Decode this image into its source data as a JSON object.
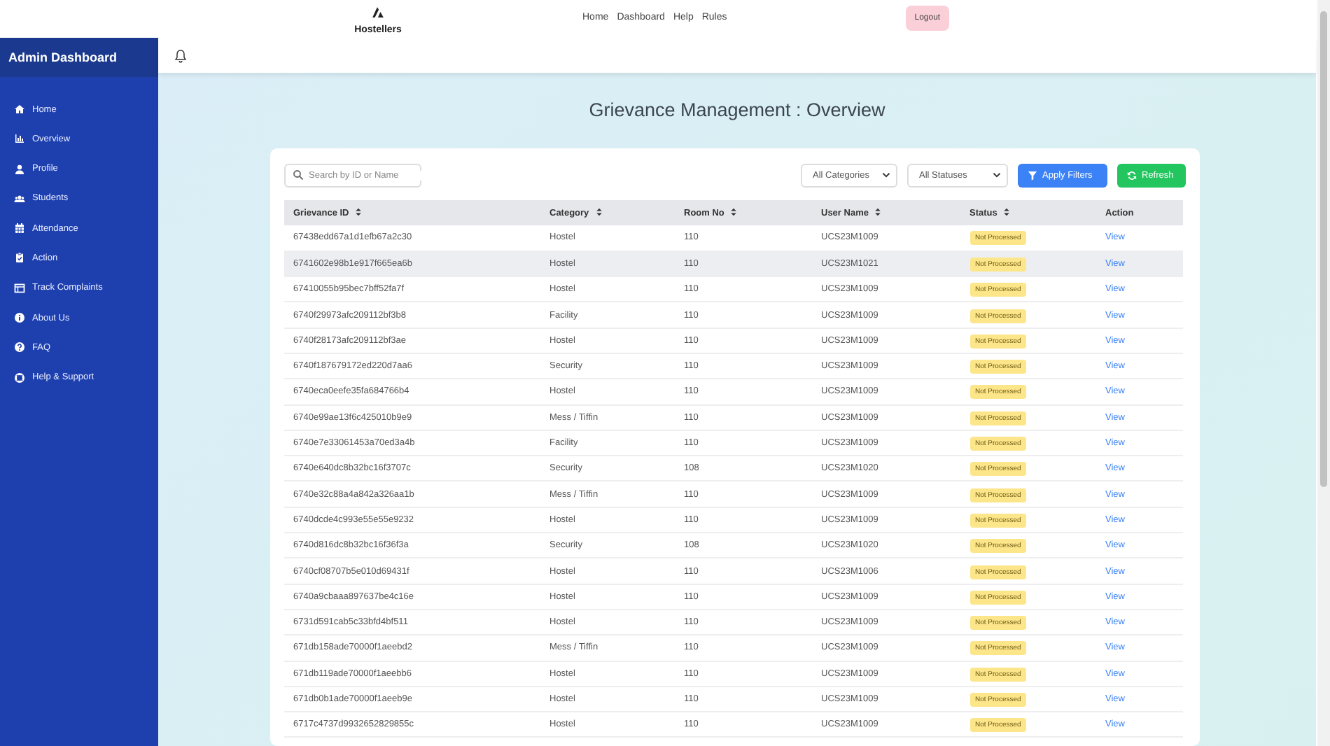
{
  "header": {
    "brand": "Hostellers",
    "nav": [
      "Home",
      "Dashboard",
      "Help",
      "Rules"
    ],
    "logout": "Logout"
  },
  "sidebar": {
    "title": "Admin Dashboard",
    "items": [
      {
        "label": "Home"
      },
      {
        "label": "Overview"
      },
      {
        "label": "Profile"
      },
      {
        "label": "Students"
      },
      {
        "label": "Attendance"
      },
      {
        "label": "Action"
      },
      {
        "label": "Track Complaints"
      },
      {
        "label": "About Us"
      },
      {
        "label": "FAQ"
      },
      {
        "label": "Help & Support"
      }
    ]
  },
  "page_title": "Grievance Management : Overview",
  "filters": {
    "search_placeholder": "Search by ID or Name",
    "category": "All Categories",
    "status": "All Statuses",
    "apply": "Apply Filters",
    "refresh": "Refresh"
  },
  "table": {
    "columns": [
      {
        "label": "Grievance ID",
        "kind": "sortable"
      },
      {
        "label": "Category",
        "kind": "sortable"
      },
      {
        "label": "Room No",
        "kind": "sortable"
      },
      {
        "label": "User Name",
        "kind": "sortable"
      },
      {
        "label": "Status",
        "kind": "sortable"
      },
      {
        "label": "Action",
        "kind": "plain"
      }
    ],
    "rows": [
      {
        "id": "67438edd67a1d1efb67a2c30",
        "category": "Hostel",
        "room": "110",
        "user": "UCS23M1009",
        "status": "Not Processed",
        "action": "View",
        "hovered": false
      },
      {
        "id": "6741602e98b1e917f665ea6b",
        "category": "Hostel",
        "room": "110",
        "user": "UCS23M1021",
        "status": "Not Processed",
        "action": "View",
        "hovered": true
      },
      {
        "id": "67410055b95bec7bff52fa7f",
        "category": "Hostel",
        "room": "110",
        "user": "UCS23M1009",
        "status": "Not Processed",
        "action": "View",
        "hovered": false
      },
      {
        "id": "6740f29973afc209112bf3b8",
        "category": "Facility",
        "room": "110",
        "user": "UCS23M1009",
        "status": "Not Processed",
        "action": "View",
        "hovered": false
      },
      {
        "id": "6740f28173afc209112bf3ae",
        "category": "Hostel",
        "room": "110",
        "user": "UCS23M1009",
        "status": "Not Processed",
        "action": "View",
        "hovered": false
      },
      {
        "id": "6740f187679172ed220d7aa6",
        "category": "Security",
        "room": "110",
        "user": "UCS23M1009",
        "status": "Not Processed",
        "action": "View",
        "hovered": false
      },
      {
        "id": "6740eca0eefe35fa684766b4",
        "category": "Hostel",
        "room": "110",
        "user": "UCS23M1009",
        "status": "Not Processed",
        "action": "View",
        "hovered": false
      },
      {
        "id": "6740e99ae13f6c425010b9e9",
        "category": "Mess / Tiffin",
        "room": "110",
        "user": "UCS23M1009",
        "status": "Not Processed",
        "action": "View",
        "hovered": false
      },
      {
        "id": "6740e7e33061453a70ed3a4b",
        "category": "Facility",
        "room": "110",
        "user": "UCS23M1009",
        "status": "Not Processed",
        "action": "View",
        "hovered": false
      },
      {
        "id": "6740e640dc8b32bc16f3707c",
        "category": "Security",
        "room": "108",
        "user": "UCS23M1020",
        "status": "Not Processed",
        "action": "View",
        "hovered": false
      },
      {
        "id": "6740e32c88a4a842a326aa1b",
        "category": "Mess / Tiffin",
        "room": "110",
        "user": "UCS23M1009",
        "status": "Not Processed",
        "action": "View",
        "hovered": false
      },
      {
        "id": "6740dcde4c993e55e55e9232",
        "category": "Hostel",
        "room": "110",
        "user": "UCS23M1009",
        "status": "Not Processed",
        "action": "View",
        "hovered": false
      },
      {
        "id": "6740d816dc8b32bc16f36f3a",
        "category": "Security",
        "room": "108",
        "user": "UCS23M1020",
        "status": "Not Processed",
        "action": "View",
        "hovered": false
      },
      {
        "id": "6740cf08707b5e010d69431f",
        "category": "Hostel",
        "room": "110",
        "user": "UCS23M1006",
        "status": "Not Processed",
        "action": "View",
        "hovered": false
      },
      {
        "id": "6740a9cbaaa897637be4c16e",
        "category": "Hostel",
        "room": "110",
        "user": "UCS23M1009",
        "status": "Not Processed",
        "action": "View",
        "hovered": false
      },
      {
        "id": "6731d591cab5c33bfd4bf511",
        "category": "Hostel",
        "room": "110",
        "user": "UCS23M1009",
        "status": "Not Processed",
        "action": "View",
        "hovered": false
      },
      {
        "id": "671db158ade70000f1aeebd2",
        "category": "Mess / Tiffin",
        "room": "110",
        "user": "UCS23M1009",
        "status": "Not Processed",
        "action": "View",
        "hovered": false
      },
      {
        "id": "671db119ade70000f1aeebb6",
        "category": "Hostel",
        "room": "110",
        "user": "UCS23M1009",
        "status": "Not Processed",
        "action": "View",
        "hovered": false
      },
      {
        "id": "671db0b1ade70000f1aeeb9e",
        "category": "Hostel",
        "room": "110",
        "user": "UCS23M1009",
        "status": "Not Processed",
        "action": "View",
        "hovered": false
      },
      {
        "id": "6717c4737d9932652829855c",
        "category": "Hostel",
        "room": "110",
        "user": "UCS23M1009",
        "status": "Not Processed",
        "action": "View",
        "hovered": false
      }
    ]
  }
}
